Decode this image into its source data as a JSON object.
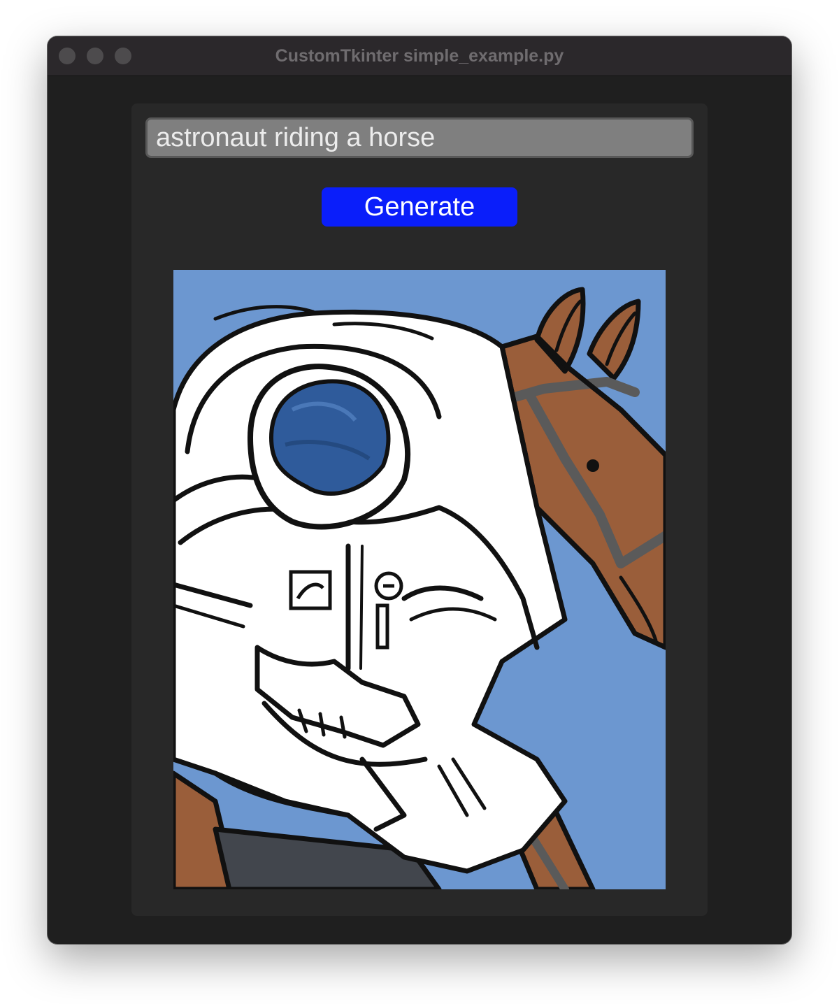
{
  "window": {
    "title": "CustomTkinter simple_example.py"
  },
  "prompt": {
    "value": "astronaut riding a horse"
  },
  "generate_button": {
    "label": "Generate",
    "color": "#0a1efa"
  },
  "generated_image": {
    "subject": "astronaut riding a horse illustration"
  },
  "colors": {
    "window_bg": "#1f1f1f",
    "frame_bg": "#282828",
    "entry_bg": "#7f7f7f",
    "sky": "#6c97d0",
    "horse": "#9a5e3a",
    "visor": "#2f5b9b"
  }
}
